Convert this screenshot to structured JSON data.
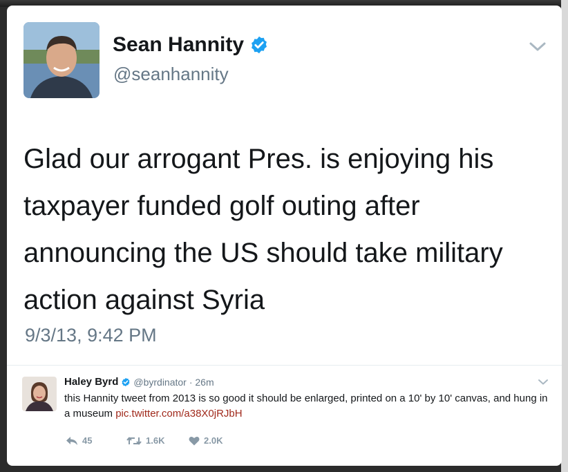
{
  "tweet": {
    "author_name": "Sean Hannity",
    "handle": "@seanhannity",
    "text": "Glad our arrogant Pres. is enjoying his taxpayer funded golf outing after announcing the US should take military action against Syria",
    "timestamp": "9/3/13, 9:42 PM"
  },
  "reply": {
    "author_name": "Haley Byrd",
    "handle": "@byrdinator",
    "time": "· 26m",
    "text": "this Hannity tweet from 2013 is so good it should be enlarged, printed on a 10' by 10' canvas, and hung in a museum",
    "link": "pic.twitter.com/a38X0jRJbH",
    "actions": {
      "reply_count": "45",
      "retweet_count": "1.6K",
      "like_count": "2.0K"
    }
  },
  "colors": {
    "verified": "#1da1f2",
    "link": "#a0291b",
    "muted": "#657786",
    "text": "#14171a"
  },
  "icons": [
    "verified-badge-icon",
    "chevron-down-icon",
    "reply-icon",
    "retweet-icon",
    "heart-icon"
  ]
}
